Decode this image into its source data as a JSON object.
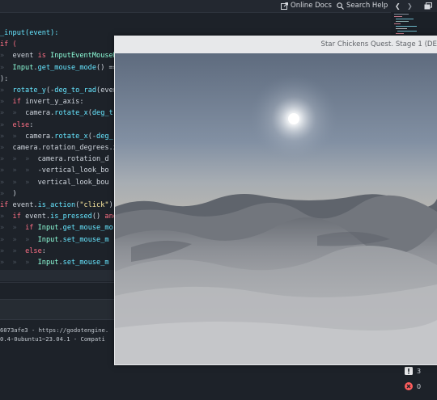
{
  "toolbar": {
    "online_docs": "Online Docs",
    "search_help": "Search Help",
    "back_glyph": "❮",
    "forward_glyph": "❯"
  },
  "code": {
    "lines": [
      [
        {
          "t": "_input(event):",
          "c": "fn-part"
        }
      ],
      [
        {
          "t": "if (",
          "c": "kw"
        }
      ],
      [
        {
          "t": "»  ",
          "c": "tabmark"
        },
        {
          "t": "event ",
          "c": ""
        },
        {
          "t": "is ",
          "c": "kw"
        },
        {
          "t": "InputEventMouseM",
          "c": "ty"
        }
      ],
      [
        {
          "t": "»  ",
          "c": "tabmark"
        },
        {
          "t": "Input",
          "c": "ty"
        },
        {
          "t": ".",
          "c": ""
        },
        {
          "t": "get_mouse_mode",
          "c": "fn"
        },
        {
          "t": "() ==",
          "c": ""
        }
      ],
      [
        {
          "t": "):",
          "c": ""
        }
      ],
      [
        {
          "t": "»  ",
          "c": "tabmark"
        },
        {
          "t": "rotate_y",
          "c": "fn"
        },
        {
          "t": "(-",
          "c": ""
        },
        {
          "t": "deg_to_rad",
          "c": "fn"
        },
        {
          "t": "(even",
          "c": ""
        }
      ],
      [
        {
          "t": "»  ",
          "c": "tabmark"
        },
        {
          "t": "if ",
          "c": "kw"
        },
        {
          "t": "invert_y_axis:",
          "c": ""
        }
      ],
      [
        {
          "t": "»  ",
          "c": "tabmark"
        },
        {
          "t": "»  ",
          "c": "tabmark"
        },
        {
          "t": "camera.",
          "c": ""
        },
        {
          "t": "rotate_x",
          "c": "fn"
        },
        {
          "t": "(",
          "c": ""
        },
        {
          "t": "deg_t",
          "c": "fn"
        }
      ],
      [
        {
          "t": "»  ",
          "c": "tabmark"
        },
        {
          "t": "else",
          "c": "kw"
        },
        {
          "t": ":",
          "c": ""
        }
      ],
      [
        {
          "t": "»  ",
          "c": "tabmark"
        },
        {
          "t": "»  ",
          "c": "tabmark"
        },
        {
          "t": "camera.",
          "c": ""
        },
        {
          "t": "rotate_x",
          "c": "fn"
        },
        {
          "t": "(-",
          "c": ""
        },
        {
          "t": "deg_",
          "c": "fn"
        }
      ],
      [
        {
          "t": "»  ",
          "c": "tabmark"
        },
        {
          "t": "camera.rotation_degrees.x",
          "c": ""
        }
      ],
      [
        {
          "t": "»  ",
          "c": "tabmark"
        },
        {
          "t": "»  ",
          "c": "tabmark"
        },
        {
          "t": "»  ",
          "c": "tabmark"
        },
        {
          "t": "camera.rotation_d",
          "c": ""
        }
      ],
      [
        {
          "t": "»  ",
          "c": "tabmark"
        },
        {
          "t": "»  ",
          "c": "tabmark"
        },
        {
          "t": "»  ",
          "c": "tabmark"
        },
        {
          "t": "-vertical_look_bo",
          "c": ""
        }
      ],
      [
        {
          "t": "»  ",
          "c": "tabmark"
        },
        {
          "t": "»  ",
          "c": "tabmark"
        },
        {
          "t": "»  ",
          "c": "tabmark"
        },
        {
          "t": "vertical_look_bou",
          "c": ""
        }
      ],
      [
        {
          "t": "»  ",
          "c": "tabmark"
        },
        {
          "t": ")",
          "c": ""
        }
      ],
      [
        {
          "t": "if ",
          "c": "kw"
        },
        {
          "t": "event.",
          "c": ""
        },
        {
          "t": "is_action",
          "c": "fn"
        },
        {
          "t": "(",
          "c": ""
        },
        {
          "t": "\"click\"",
          "c": "str"
        },
        {
          "t": "):",
          "c": ""
        }
      ],
      [
        {
          "t": "»  ",
          "c": "tabmark"
        },
        {
          "t": "if ",
          "c": "kw"
        },
        {
          "t": "event.",
          "c": ""
        },
        {
          "t": "is_pressed",
          "c": "fn"
        },
        {
          "t": "() ",
          "c": ""
        },
        {
          "t": "and",
          "c": "kw"
        }
      ],
      [
        {
          "t": "»  ",
          "c": "tabmark"
        },
        {
          "t": "»  ",
          "c": "tabmark"
        },
        {
          "t": "if ",
          "c": "kw"
        },
        {
          "t": "Input",
          "c": "ty"
        },
        {
          "t": ".",
          "c": ""
        },
        {
          "t": "get_mouse_mo",
          "c": "fn"
        }
      ],
      [
        {
          "t": "»  ",
          "c": "tabmark"
        },
        {
          "t": "»  ",
          "c": "tabmark"
        },
        {
          "t": "»  ",
          "c": "tabmark"
        },
        {
          "t": "Input",
          "c": "ty"
        },
        {
          "t": ".",
          "c": ""
        },
        {
          "t": "set_mouse_m",
          "c": "fn"
        }
      ],
      [
        {
          "t": "»  ",
          "c": "tabmark"
        },
        {
          "t": "»  ",
          "c": "tabmark"
        },
        {
          "t": "else",
          "c": "kw"
        },
        {
          "t": ":",
          "c": ""
        }
      ],
      [
        {
          "t": "»  ",
          "c": "tabmark"
        },
        {
          "t": "»  ",
          "c": "tabmark"
        },
        {
          "t": "»  ",
          "c": "tabmark"
        },
        {
          "t": "Input",
          "c": "ty"
        },
        {
          "t": ".",
          "c": ""
        },
        {
          "t": "set_mouse_m",
          "c": "fn"
        }
      ]
    ]
  },
  "output": {
    "lines": [
      "6073afe3 - https://godotengine.",
      "0.4-0ubuntu1~23.04.1 - Compati"
    ]
  },
  "status": {
    "warnings": "3",
    "errors": "0"
  },
  "game_window": {
    "title": "Star Chickens Quest. Stage 1 (DE"
  }
}
